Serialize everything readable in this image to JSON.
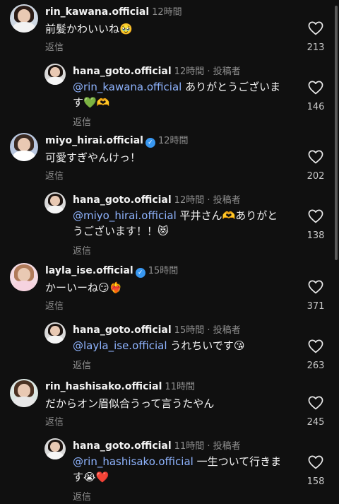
{
  "comments": [
    {
      "user": "rin_kawana.official",
      "verified": false,
      "time": "12時間",
      "text_a": "",
      "text_b": "前髪かわいいね",
      "emoji": "🥹",
      "reply_label": "返信",
      "likes": "213",
      "reply": {
        "user": "hana_goto.official",
        "time": "12時間",
        "author_tag": "投稿者",
        "mention": "@rin_kawana.official",
        "text_b": " ありがとうございます",
        "emoji": "💚🫶",
        "reply_label": "返信",
        "likes": "146"
      }
    },
    {
      "user": "miyo_hirai.official",
      "verified": true,
      "time": "12時間",
      "text_b": "可愛すぎやんけっ！",
      "emoji": "",
      "reply_label": "返信",
      "likes": "202",
      "reply": {
        "user": "hana_goto.official",
        "time": "12時間",
        "author_tag": "投稿者",
        "mention": "@miyo_hirai.official",
        "text_b": " 平井さん🫶ありがとうございます！！",
        "emoji": "😻",
        "reply_label": "返信",
        "likes": "138"
      }
    },
    {
      "user": "layla_ise.official",
      "verified": true,
      "time": "15時間",
      "text_b": "かーいーね",
      "emoji": "😏❤️‍🔥",
      "reply_label": "返信",
      "likes": "371",
      "reply": {
        "user": "hana_goto.official",
        "time": "15時間",
        "author_tag": "投稿者",
        "mention": "@layla_ise.official",
        "text_b": " うれちいです",
        "emoji": "😘",
        "reply_label": "返信",
        "likes": "263"
      }
    },
    {
      "user": "rin_hashisako.official",
      "verified": false,
      "time": "11時間",
      "text_b": "だからオン眉似合うって言うたやん",
      "emoji": "",
      "reply_label": "返信",
      "likes": "245",
      "reply": {
        "user": "hana_goto.official",
        "time": "11時間",
        "author_tag": "投稿者",
        "mention": "@rin_hashisako.official",
        "text_b": " 一生ついて行きます",
        "emoji": "😭❤️",
        "reply_label": "返信",
        "likes": "158"
      }
    }
  ],
  "icons": {
    "like": "heart-outline-icon",
    "verified": "verified-badge-icon"
  },
  "colors": {
    "background": "#101010",
    "mention": "#8fb4ff",
    "meta": "#8e8e8e",
    "verified": "#3897f0"
  }
}
